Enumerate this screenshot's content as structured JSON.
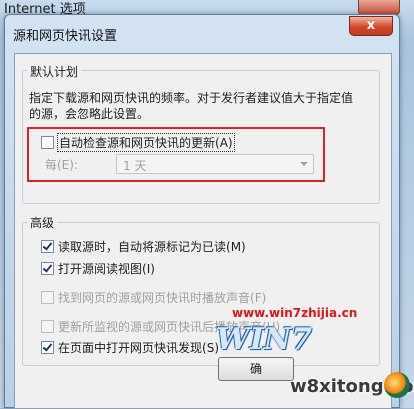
{
  "parent_window": {
    "title": "Internet 选项"
  },
  "dialog": {
    "title": "源和网页快讯设置",
    "close_glyph": "x"
  },
  "default_schedule": {
    "legend": "默认计划",
    "description": "指定下载源和网页快讯的频率。对于发行者建议值大于指定值的源，会忽略此设置。",
    "auto_check": {
      "label": "自动检查源和网页快讯的更新",
      "key": "(A)",
      "checked": false
    },
    "every": {
      "label": "每(E):",
      "value": "1 天",
      "enabled": false
    }
  },
  "advanced": {
    "legend": "高级",
    "options": [
      {
        "label": "读取源时，自动将源标记为已读",
        "key": "(M)",
        "checked": true,
        "enabled": true
      },
      {
        "label": "打开源阅读视图",
        "key": "(I)",
        "checked": true,
        "enabled": true
      },
      {
        "label": "找到网页的源或网页快讯时播放声音",
        "key": "(F)",
        "checked": false,
        "enabled": false
      },
      {
        "label": "更新所监视的源或网页快讯后播放声音",
        "key": "(U)",
        "checked": false,
        "enabled": false
      },
      {
        "label": "在页面中打开网页快讯发现",
        "key": "(S)",
        "checked": true,
        "enabled": true
      }
    ]
  },
  "ok_button": {
    "label": "确"
  },
  "watermarks": {
    "site1": "www.win7zhijia.cn",
    "logo": "WIN7",
    "site2": "w8xitong.com"
  },
  "colors": {
    "highlight_border": "#d9262b",
    "watermark_red": "#e0141c"
  }
}
